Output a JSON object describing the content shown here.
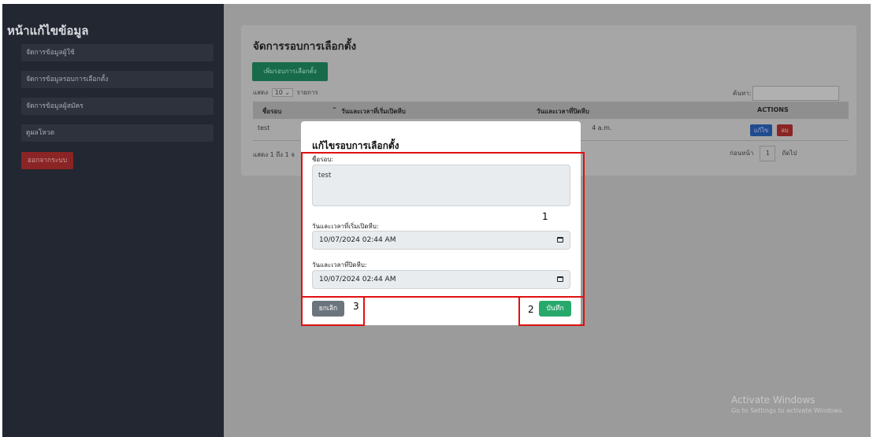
{
  "sidebar": {
    "title": "หน้าแก้ไขข้อมูล",
    "items": [
      "จัดการข้อมูลผู้ใช้",
      "จัดการข้อมูลรอบการเลือกตั้ง",
      "จัดการข้อมูลผู้สมัคร",
      "ดูผลโหวต"
    ],
    "logout": "ออกจากระบบ"
  },
  "main": {
    "title": "จัดการรอบการเลือกตั้ง",
    "add_button": "เพิ่มรอบการเลือกตั้ง",
    "length_prefix": "แสดง",
    "length_value": "10",
    "length_suffix": "รายการ",
    "search_label": "ค้นหา:",
    "columns": [
      "ชื่อรอบ",
      "วันและเวลาที่เริ่มเปิดหีบ",
      "วันและเวลาที่ปิดหีบ",
      "ACTIONS"
    ],
    "row": {
      "name": "test",
      "end_fragment": "4 a.m.",
      "edit": "แก้ไข",
      "delete": "ลบ"
    },
    "info": "แสดง 1 ถึง 1 จ",
    "pager": {
      "prev": "ก่อนหน้า",
      "page": "1",
      "next": "ถัดไป"
    }
  },
  "modal": {
    "title": "แก้ไขรอบการเลือกตั้ง",
    "name_label": "ชื่อรอบ:",
    "name_value": "test",
    "start_label": "วันและเวลาที่เริ่มเปิดหีบ:",
    "start_value": "10/07/2024 02:44 AM",
    "end_label": "วันและเวลาที่ปิดหีบ:",
    "end_value": "10/07/2024 02:44 AM",
    "cancel": "ยกเลิก",
    "save": "บันทึก"
  },
  "annotations": {
    "n1": "1",
    "n2": "2",
    "n3": "3"
  },
  "watermark": {
    "line1": "Activate Windows",
    "line2": "Go to Settings to activate Windows."
  },
  "colors": {
    "sidebar": "#232731",
    "save": "#28a96c",
    "cancel": "#6c757d",
    "highlight": "#e01010"
  }
}
